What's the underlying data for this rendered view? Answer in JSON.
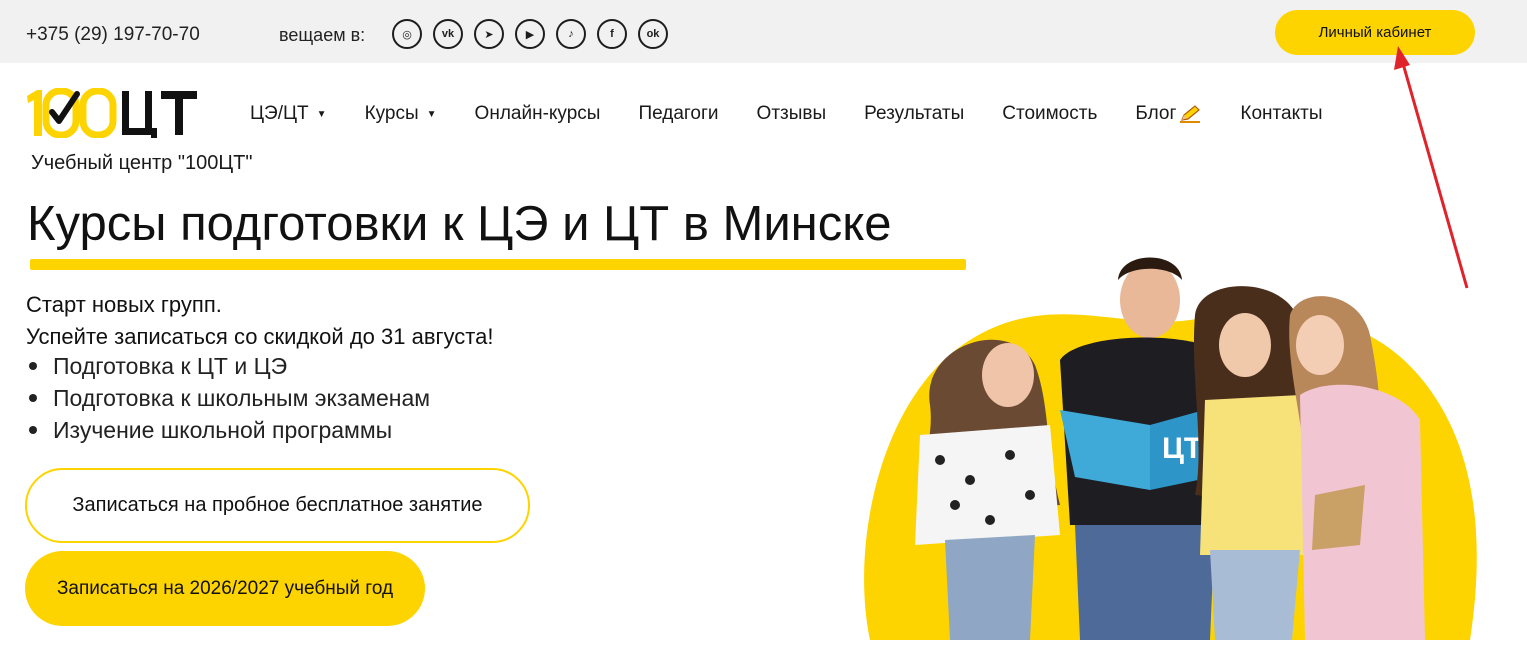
{
  "topbar": {
    "phone": "+375 (29) 197-70-70",
    "broadcast_label": "вещаем в:",
    "socials": [
      {
        "name": "instagram-icon",
        "glyph": "◎"
      },
      {
        "name": "vk-icon",
        "glyph": "vk"
      },
      {
        "name": "telegram-icon",
        "glyph": "➤"
      },
      {
        "name": "youtube-icon",
        "glyph": "▶"
      },
      {
        "name": "tiktok-icon",
        "glyph": "♪"
      },
      {
        "name": "facebook-icon",
        "glyph": "f"
      },
      {
        "name": "odnoklassniki-icon",
        "glyph": "ok"
      }
    ],
    "cabinet_label": "Личный кабинет"
  },
  "header": {
    "logo_text": "100ЦТ",
    "nav": [
      {
        "label": "ЦЭ/ЦТ",
        "dropdown": true
      },
      {
        "label": "Курсы",
        "dropdown": true
      },
      {
        "label": "Онлайн-курсы",
        "dropdown": false
      },
      {
        "label": "Педагоги",
        "dropdown": false
      },
      {
        "label": "Отзывы",
        "dropdown": false
      },
      {
        "label": "Результаты",
        "dropdown": false
      },
      {
        "label": "Стоимость",
        "dropdown": false
      },
      {
        "label": "Блог",
        "dropdown": false
      },
      {
        "label": "Контакты",
        "dropdown": false
      }
    ],
    "subtitle": "Учебный центр \"100ЦТ\""
  },
  "hero": {
    "title": "Курсы подготовки к ЦЭ и ЦТ в Минске",
    "lead_line1": "Старт новых групп.",
    "lead_line2": "Успейте записаться со скидкой до 31 августа!",
    "bullets": [
      "Подготовка к ЦТ и ЦЭ",
      "Подготовка к школьным экзаменам",
      "Изучение школьной программы"
    ],
    "trial_button": "Записаться на пробное бесплатное занятие",
    "year_button": "Записаться на 2026/2027 учебный год",
    "book_label": "ЦТ"
  },
  "colors": {
    "accent": "#fdd400",
    "topbar_bg": "#f1f1f1",
    "annotation_arrow": "#e0232b"
  }
}
